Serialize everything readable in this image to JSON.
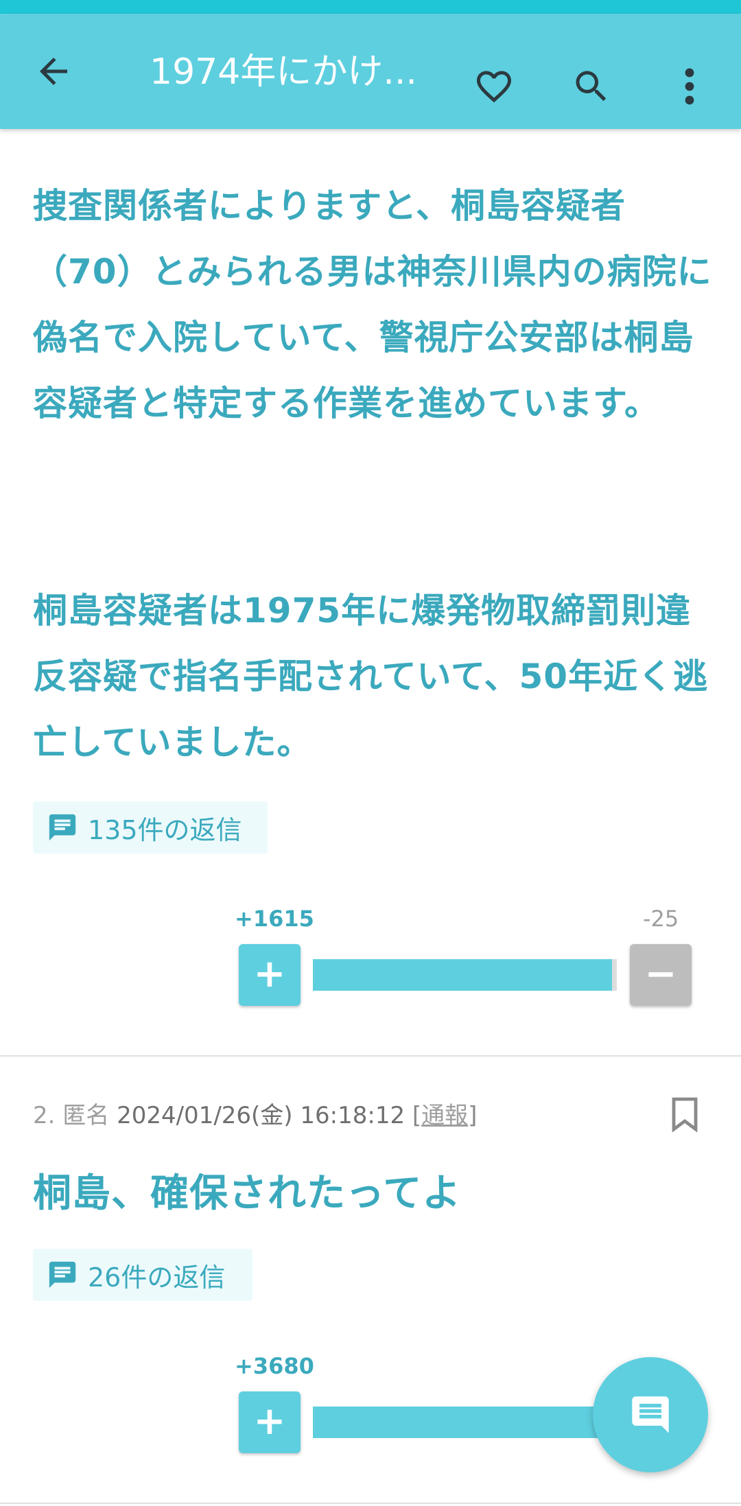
{
  "app_bar": {
    "title": "1974年にかけ...",
    "icons": [
      "back-arrow-icon",
      "heart-icon",
      "search-icon",
      "more-vert-icon"
    ]
  },
  "colors": {
    "accent": "#5ecfdf",
    "text_accent": "#3ba9bd",
    "minus_gray": "#bdbdbd"
  },
  "post1": {
    "paragraph1": "捜査関係者によりますと、桐島容疑者（70）とみられる男は神奈川県内の病院に偽名で入院していて、警視庁公安部は桐島容疑者と特定する作業を進めています。",
    "paragraph2": "桐島容疑者は1975年に爆発物取締罰則違反容疑で指名手配されていて、50年近く逃亡していました。",
    "replies_label": "135件の返信",
    "votes": {
      "plus_label": "+1615",
      "minus_label": "-25",
      "plus_fraction": 0.985
    }
  },
  "post2": {
    "number": "2.",
    "author": "匿名",
    "datetime": "2024/01/26(金) 16:18:12",
    "report_open": "[",
    "report_label": "通報",
    "report_close": "]",
    "text": "桐島、確保されたってよ",
    "replies_label": "26件の返信",
    "votes": {
      "plus_label": "+3680",
      "plus_fraction": 1.0
    }
  },
  "vote_buttons": {
    "plus": "+",
    "minus": "−"
  },
  "fab": {
    "icon": "chat-bubble-icon"
  }
}
